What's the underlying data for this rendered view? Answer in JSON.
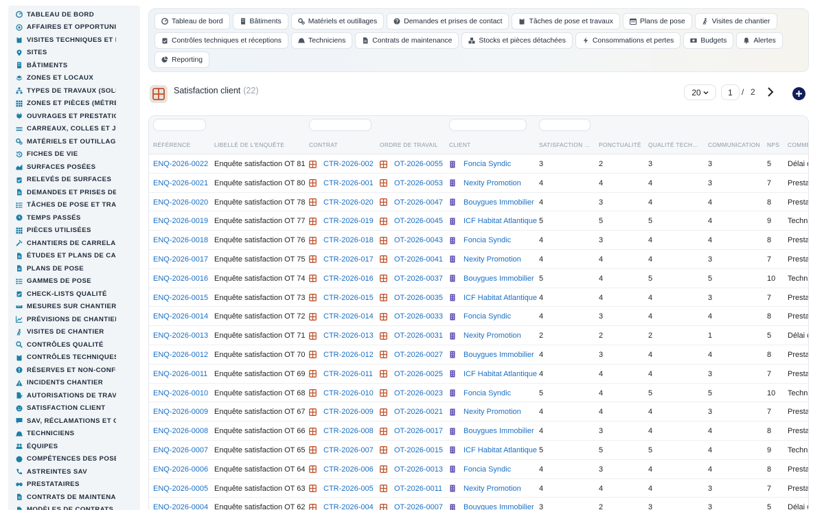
{
  "sidebar": {
    "items": [
      {
        "label": "TABLEAU DE BORD",
        "icon": "gauge-icon"
      },
      {
        "label": "AFFAIRES ET OPPORTUNITÉS",
        "icon": "target-icon"
      },
      {
        "label": "VISITES TECHNIQUES ET MÉTRÉS",
        "icon": "clipboard-icon"
      },
      {
        "label": "SITES",
        "icon": "map-pin-icon"
      },
      {
        "label": "BÂTIMENTS",
        "icon": "building-icon"
      },
      {
        "label": "ZONES ET LOCAUX",
        "icon": "layers-icon"
      },
      {
        "label": "TYPES DE TRAVAUX (SOLS…",
        "icon": "sitemap-icon"
      },
      {
        "label": "ZONES ET PIÈCES (MÉTRÉS)",
        "icon": "grid-icon"
      },
      {
        "label": "OUVRAGES ET PRESTATIONS",
        "icon": "plug-icon"
      },
      {
        "label": "CARREAUX, COLLES ET JOINTS",
        "icon": "equals-icon"
      },
      {
        "label": "MATÉRIELS ET OUTILLAGES",
        "icon": "gears-icon"
      },
      {
        "label": "FICHES DE VIE",
        "icon": "history-icon"
      },
      {
        "label": "SURFACES POSÉES",
        "icon": "area-chart-icon"
      },
      {
        "label": "RELEVÉS DE SURFACES",
        "icon": "clipboard-check-icon"
      },
      {
        "label": "DEMANDES ET PRISES DE…",
        "icon": "doc-icon"
      },
      {
        "label": "TÂCHES DE POSE ET TRAVAUX",
        "icon": "list-icon"
      },
      {
        "label": "TEMPS PASSÉS",
        "icon": "clock-icon"
      },
      {
        "label": "PIÈCES UTILISÉES",
        "icon": "grid-icon"
      },
      {
        "label": "CHANTIERS DE CARRELAGE",
        "icon": "hammer-icon"
      },
      {
        "label": "ÉTUDES ET PLANS DE CALEPINAGE",
        "icon": "doc-icon"
      },
      {
        "label": "PLANS DE POSE",
        "icon": "doc-icon"
      },
      {
        "label": "GAMMES DE POSE",
        "icon": "list-icon"
      },
      {
        "label": "CHECK-LISTS QUALITÉ",
        "icon": "clipboard-check-icon"
      },
      {
        "label": "MESURES SUR CHANTIER",
        "icon": "ruler-icon"
      },
      {
        "label": "PRÉVISIONS DE CHANTIER",
        "icon": "line-chart-icon"
      },
      {
        "label": "VISITES DE CHANTIER",
        "icon": "walk-icon"
      },
      {
        "label": "CONTRÔLES QUALITÉ",
        "icon": "search-icon"
      },
      {
        "label": "CONTRÔLES TECHNIQUES",
        "icon": "clipboard-icon"
      },
      {
        "label": "RÉSERVES ET NON-CONFORMITÉS",
        "icon": "alert-circle-icon"
      },
      {
        "label": "INCIDENTS CHANTIER",
        "icon": "warning-icon"
      },
      {
        "label": "AUTORISATIONS DE TRAVAUX",
        "icon": "doc-edit-icon"
      },
      {
        "label": "SATISFACTION CLIENT",
        "icon": "smile-icon"
      },
      {
        "label": "SAV, RÉCLAMATIONS ET GARANTIES",
        "icon": "chat-icon"
      },
      {
        "label": "TECHNICIENS",
        "icon": "helmet-icon"
      },
      {
        "label": "ÉQUIPES",
        "icon": "users-icon"
      },
      {
        "label": "COMPÉTENCES DES POSEURS",
        "icon": "badge-icon"
      },
      {
        "label": "ASTREINTES SAV",
        "icon": "phone-icon"
      },
      {
        "label": "PRESTATAIRES",
        "icon": "handshake-icon"
      },
      {
        "label": "CONTRATS DE MAINTENANCE",
        "icon": "doc-icon"
      },
      {
        "label": "MODÈLES DE CONTRATS",
        "icon": "doc-icon"
      }
    ]
  },
  "topnav": {
    "row1": [
      {
        "label": "Tableau de bord",
        "icon": "gauge-icon"
      },
      {
        "label": "Bâtiments",
        "icon": "building-icon"
      },
      {
        "label": "Matériels et outillages",
        "icon": "gears-icon"
      },
      {
        "label": "Demandes et prises de contact",
        "icon": "question-icon"
      },
      {
        "label": "Tâches de pose et travaux",
        "icon": "clipboard-icon"
      },
      {
        "label": "Plans de pose",
        "icon": "calendar-icon"
      },
      {
        "label": "Visites de chantier",
        "icon": "walk-icon"
      }
    ],
    "row2": [
      {
        "label": "Contrôles techniques et réceptions",
        "icon": "clipboard-check-icon"
      },
      {
        "label": "Techniciens",
        "icon": "helmet-icon"
      },
      {
        "label": "Contrats de maintenance",
        "icon": "doc-icon"
      },
      {
        "label": "Stocks et pièces détachées",
        "icon": "boxes-icon"
      },
      {
        "label": "Consommations et pertes",
        "icon": "bolt-icon"
      },
      {
        "label": "Budgets",
        "icon": "money-icon"
      },
      {
        "label": "Alertes",
        "icon": "bell-icon"
      }
    ],
    "row3": [
      {
        "label": "Reporting",
        "icon": "pie-icon"
      }
    ]
  },
  "page": {
    "title": "Satisfaction client",
    "count": "(22)",
    "page_size": "20",
    "current_page": "1",
    "separator": "/",
    "total_pages": "2"
  },
  "table": {
    "headers": [
      "RÉFÉRENCE",
      "LIBELLÉ DE L'ENQUÊTE",
      "CONTRAT",
      "ORDRE DE TRAVAIL",
      "CLIENT",
      "SATISFACTION …",
      "PONCTUALITÉ",
      "QUALITÉ TECH…",
      "COMMUNICATION",
      "NPS",
      "COMME…"
    ],
    "rows": [
      {
        "ref": "ENQ-2026-0022",
        "label": "Enquête satisfaction OT 81",
        "contract": "CTR-2026-002",
        "order": "OT-2026-0055",
        "client": "Foncia Syndic",
        "satisfaction": "3",
        "ponctualite": "2",
        "qualite": "3",
        "communication": "3",
        "nps": "5",
        "comment": "Délai dépassé"
      },
      {
        "ref": "ENQ-2026-0021",
        "label": "Enquête satisfaction OT 80",
        "contract": "CTR-2026-001",
        "order": "OT-2026-0053",
        "client": "Nexity Promotion",
        "satisfaction": "4",
        "ponctualite": "4",
        "qualite": "4",
        "communication": "3",
        "nps": "7",
        "comment": "Prestation correcte"
      },
      {
        "ref": "ENQ-2026-0020",
        "label": "Enquête satisfaction OT 78",
        "contract": "CTR-2026-020",
        "order": "OT-2026-0047",
        "client": "Bouygues Immobilier",
        "satisfaction": "4",
        "ponctualite": "3",
        "qualite": "4",
        "communication": "4",
        "nps": "8",
        "comment": "Prestation correcte"
      },
      {
        "ref": "ENQ-2026-0019",
        "label": "Enquête satisfaction OT 77",
        "contract": "CTR-2026-019",
        "order": "OT-2026-0045",
        "client": "ICF Habitat Atlantique",
        "satisfaction": "5",
        "ponctualite": "5",
        "qualite": "5",
        "communication": "4",
        "nps": "9",
        "comment": "Technicien à l'écoute"
      },
      {
        "ref": "ENQ-2026-0018",
        "label": "Enquête satisfaction OT 76",
        "contract": "CTR-2026-018",
        "order": "OT-2026-0043",
        "client": "Foncia Syndic",
        "satisfaction": "4",
        "ponctualite": "3",
        "qualite": "4",
        "communication": "4",
        "nps": "8",
        "comment": "Prestation correcte"
      },
      {
        "ref": "ENQ-2026-0017",
        "label": "Enquête satisfaction OT 75",
        "contract": "CTR-2026-017",
        "order": "OT-2026-0041",
        "client": "Nexity Promotion",
        "satisfaction": "4",
        "ponctualite": "4",
        "qualite": "4",
        "communication": "3",
        "nps": "7",
        "comment": "Prestation correcte"
      },
      {
        "ref": "ENQ-2026-0016",
        "label": "Enquête satisfaction OT 74",
        "contract": "CTR-2026-016",
        "order": "OT-2026-0037",
        "client": "Bouygues Immobilier",
        "satisfaction": "5",
        "ponctualite": "4",
        "qualite": "5",
        "communication": "5",
        "nps": "10",
        "comment": "Technicien à l'écoute"
      },
      {
        "ref": "ENQ-2026-0015",
        "label": "Enquête satisfaction OT 73",
        "contract": "CTR-2026-015",
        "order": "OT-2026-0035",
        "client": "ICF Habitat Atlantique",
        "satisfaction": "4",
        "ponctualite": "4",
        "qualite": "4",
        "communication": "3",
        "nps": "7",
        "comment": "Prestation correcte"
      },
      {
        "ref": "ENQ-2026-0014",
        "label": "Enquête satisfaction OT 72",
        "contract": "CTR-2026-014",
        "order": "OT-2026-0033",
        "client": "Foncia Syndic",
        "satisfaction": "4",
        "ponctualite": "3",
        "qualite": "4",
        "communication": "4",
        "nps": "8",
        "comment": "Prestation correcte"
      },
      {
        "ref": "ENQ-2026-0013",
        "label": "Enquête satisfaction OT 71",
        "contract": "CTR-2026-013",
        "order": "OT-2026-0031",
        "client": "Nexity Promotion",
        "satisfaction": "2",
        "ponctualite": "2",
        "qualite": "2",
        "communication": "1",
        "nps": "5",
        "comment": "Délai dépassé"
      },
      {
        "ref": "ENQ-2026-0012",
        "label": "Enquête satisfaction OT 70",
        "contract": "CTR-2026-012",
        "order": "OT-2026-0027",
        "client": "Bouygues Immobilier",
        "satisfaction": "4",
        "ponctualite": "3",
        "qualite": "4",
        "communication": "4",
        "nps": "8",
        "comment": "Prestation correcte"
      },
      {
        "ref": "ENQ-2026-0011",
        "label": "Enquête satisfaction OT 69",
        "contract": "CTR-2026-011",
        "order": "OT-2026-0025",
        "client": "ICF Habitat Atlantique",
        "satisfaction": "4",
        "ponctualite": "4",
        "qualite": "4",
        "communication": "3",
        "nps": "7",
        "comment": "Prestation correcte"
      },
      {
        "ref": "ENQ-2026-0010",
        "label": "Enquête satisfaction OT 68",
        "contract": "CTR-2026-010",
        "order": "OT-2026-0023",
        "client": "Foncia Syndic",
        "satisfaction": "5",
        "ponctualite": "4",
        "qualite": "5",
        "communication": "5",
        "nps": "10",
        "comment": "Technicien à l'écoute"
      },
      {
        "ref": "ENQ-2026-0009",
        "label": "Enquête satisfaction OT 67",
        "contract": "CTR-2026-009",
        "order": "OT-2026-0021",
        "client": "Nexity Promotion",
        "satisfaction": "4",
        "ponctualite": "4",
        "qualite": "4",
        "communication": "3",
        "nps": "7",
        "comment": "Prestation correcte"
      },
      {
        "ref": "ENQ-2026-0008",
        "label": "Enquête satisfaction OT 66",
        "contract": "CTR-2026-008",
        "order": "OT-2026-0017",
        "client": "Bouygues Immobilier",
        "satisfaction": "4",
        "ponctualite": "3",
        "qualite": "4",
        "communication": "4",
        "nps": "8",
        "comment": "Prestation correcte"
      },
      {
        "ref": "ENQ-2026-0007",
        "label": "Enquête satisfaction OT 65",
        "contract": "CTR-2026-007",
        "order": "OT-2026-0015",
        "client": "ICF Habitat Atlantique",
        "satisfaction": "5",
        "ponctualite": "5",
        "qualite": "5",
        "communication": "4",
        "nps": "9",
        "comment": "Technicien à l'écoute"
      },
      {
        "ref": "ENQ-2026-0006",
        "label": "Enquête satisfaction OT 64",
        "contract": "CTR-2026-006",
        "order": "OT-2026-0013",
        "client": "Foncia Syndic",
        "satisfaction": "4",
        "ponctualite": "3",
        "qualite": "4",
        "communication": "4",
        "nps": "8",
        "comment": "Prestation correcte"
      },
      {
        "ref": "ENQ-2026-0005",
        "label": "Enquête satisfaction OT 63",
        "contract": "CTR-2026-005",
        "order": "OT-2026-0011",
        "client": "Nexity Promotion",
        "satisfaction": "4",
        "ponctualite": "4",
        "qualite": "4",
        "communication": "3",
        "nps": "7",
        "comment": "Prestation correcte"
      },
      {
        "ref": "ENQ-2026-0004",
        "label": "Enquête satisfaction OT 62",
        "contract": "CTR-2026-004",
        "order": "OT-2026-0007",
        "client": "Bouygues Immobilier",
        "satisfaction": "3",
        "ponctualite": "2",
        "qualite": "3",
        "communication": "3",
        "nps": "5",
        "comment": "Délai dépassé"
      }
    ]
  },
  "colors": {
    "link": "#1a6fc4",
    "sidebar_icon": "#1b7fa6",
    "contract_icon": "#c0512a",
    "client_icon": "#5b4bb4",
    "add_button": "#101e5a"
  }
}
